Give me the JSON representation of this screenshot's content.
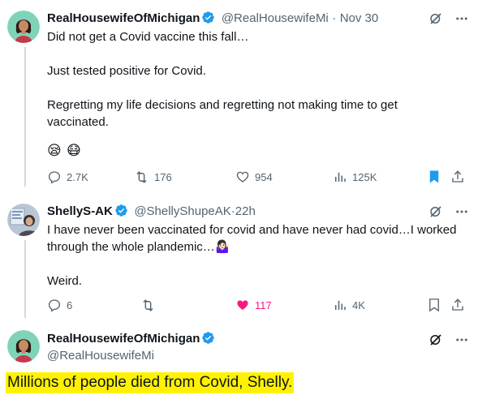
{
  "tweet1": {
    "name": "RealHousewifeOfMichigan",
    "handle": "@RealHousewifeMi",
    "separator": "·",
    "date": "Nov 30",
    "lines": [
      "Did not get a Covid vaccine this fall…",
      "Just tested positive for Covid.",
      "Regretting my life decisions and regretting not making time to get",
      "vaccinated."
    ],
    "emojis": [
      "😪",
      "😷"
    ],
    "replies": "2.7K",
    "reposts": "176",
    "likes": "954",
    "views": "125K"
  },
  "tweet2": {
    "name": "ShellyS-AK",
    "handle": "@ShellyShupeAK",
    "separator": "·",
    "date": "22h",
    "lines": [
      "I have never been vaccinated for covid and have never had covid…I worked",
      "through the whole plandemic…",
      "Weird."
    ],
    "emoji": "🤷🏻‍♀️",
    "replies": "6",
    "reposts": "",
    "likes": "117",
    "views": "4K"
  },
  "tweet3": {
    "name": "RealHousewifeOfMichigan",
    "handle": "@RealHousewifeMi",
    "text": "Millions of people died from Covid, Shelly."
  },
  "colors": {
    "verified_blue": "#1d9bf0",
    "like_pink": "#f91880",
    "highlight_yellow": "#fff200",
    "muted_gray": "#536471"
  },
  "icons": [
    "verified-badge-icon",
    "grok-icon",
    "more-icon",
    "reply-icon",
    "repost-icon",
    "like-icon",
    "views-icon",
    "bookmark-icon",
    "share-icon"
  ]
}
